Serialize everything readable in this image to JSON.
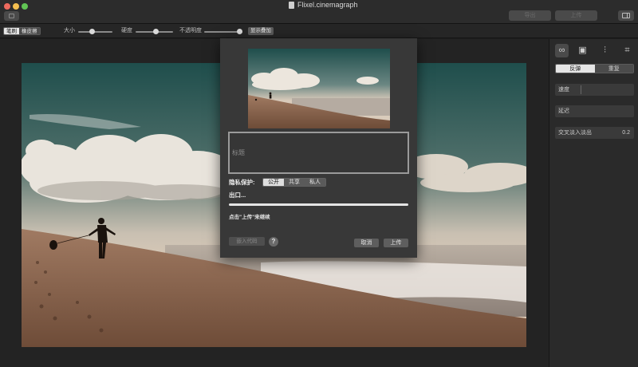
{
  "window": {
    "title": "Flixel.cinemagraph",
    "export_label": "导出",
    "upload_label": "上传"
  },
  "toolbar": {
    "brush_label": "笔刷",
    "eraser_label": "橡皮擦",
    "size_label": "大小",
    "hardness_label": "硬度",
    "opacity_label": "不透明度",
    "show_overlay_label": "显示叠加",
    "size_value": 0.4,
    "hardness_value": 0.55,
    "opacity_value": 1.0
  },
  "right_panel": {
    "tabs": [
      "loop-icon",
      "photo-icon",
      "sliders-icon",
      "crop-icon"
    ],
    "mode_bounce": "反弹",
    "mode_repeat": "重复",
    "speed_label": "速度",
    "delay_label": "延迟",
    "crossfade_label": "交叉淡入淡出",
    "crossfade_value": "0.2"
  },
  "dialog": {
    "title_placeholder": "标题",
    "privacy_label": "隐私保护:",
    "privacy_options": [
      "公开",
      "共享",
      "私人"
    ],
    "privacy_selected": "公开",
    "export_status": "出口...",
    "progress": 1.0,
    "hint": "点击\"上传\"来继续",
    "embed_code_label": "嵌入代码",
    "help_label": "?",
    "cancel_label": "取消",
    "upload_label": "上传"
  },
  "colors": {
    "sky_top": "#1f4e4c",
    "sand": "#9a7258",
    "window_bg": "#1e1e1e"
  }
}
